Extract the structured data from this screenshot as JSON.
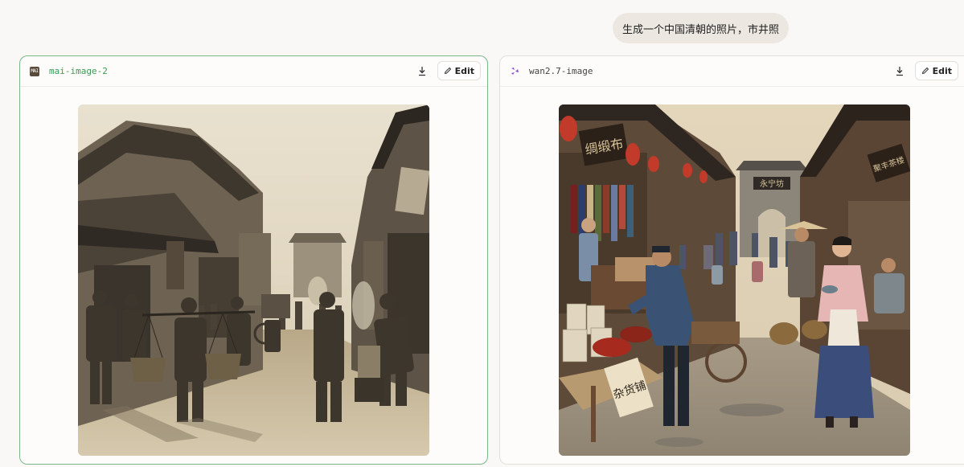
{
  "chat": {
    "prompt": "生成一个中国清朝的照片，市井照"
  },
  "panels": [
    {
      "model_name": "mai-image-2",
      "logo_text": "MAI",
      "logo_icon": "mai-logo-icon",
      "edit_label": "Edit",
      "selected": true,
      "image_description": "Sepia photograph of a Qing dynasty street scene with porters carrying baskets on shoulder poles and a vendor at a steamer"
    },
    {
      "model_name": "wan2.7-image",
      "logo_icon": "wan-logo-icon",
      "edit_label": "Edit",
      "selected": false,
      "image_description": "Colorized Qing dynasty market street with red lanterns, a vendor at a cart of chili baskets, and a woman in a pink jacket and apron",
      "signs": {
        "left_shop": "绸缎布",
        "gate": "永宁坊",
        "right_shop": "聚丰茶楼",
        "cart": "杂货铺"
      }
    }
  ],
  "colors": {
    "selected_border": "#7ab88a",
    "left_model_text": "#3a9a52",
    "wan_logo": "#8a4fd8",
    "background": "#f9f8f6"
  }
}
